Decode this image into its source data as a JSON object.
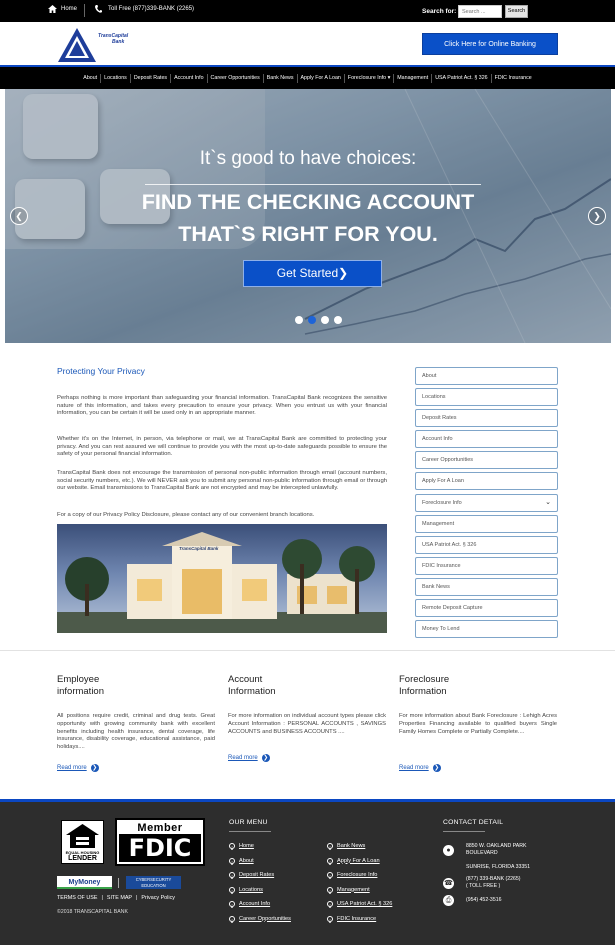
{
  "topbar": {
    "home": "Home",
    "tollfree": "Toll Free (877)339-BANK (2265)",
    "search_label": "Search for:",
    "search_placeholder": "Search ...",
    "search_button": "Search"
  },
  "header": {
    "logo_text_1": "TransCapital",
    "logo_text_2": "Bank",
    "online_banking": "Click Here for Online Banking"
  },
  "nav": [
    "About",
    "Locations",
    "Deposit Rates",
    "Account Info",
    "Career Opportunities",
    "Bank News",
    "Apply For A Loan",
    "Foreclosure Info ▾",
    "Management",
    "USA Patriot Act. § 326",
    "FDIC Insurance"
  ],
  "hero": {
    "line1": "It`s good to have choices:",
    "line2": "FIND THE CHECKING ACCOUNT",
    "line3": "THAT`S RIGHT FOR YOU.",
    "cta": "Get Started❯"
  },
  "privacy": {
    "title": "Protecting Your Privacy",
    "p1": "Perhaps nothing is more important than safeguarding your financial information. TransCapital Bank recognizes the sensitive nature of this information, and takes every precaution to ensure your privacy. When you entrust us with your financial information, you can be certain it will be used only in an appropriate manner.",
    "p2": "Whether it's on the Internet, in person, via telephone or mail, we at TransCapital Bank are committed to protecting your privacy. And you can rest assured we will continue to provide you with the most up-to-date safeguards possible to ensure the safety of your personal financial information.",
    "p3": "TransCapital Bank does not encourage the transmission of personal non-public information through email (account numbers, social security numbers, etc.). We will NEVER ask you to submit any personal non-public information through email or through our website. Email transmissions to TransCapital Bank are not encrypted and may be intercepted unlawfully.",
    "p4": "For a copy of our Privacy Policy Disclosure, please contact any of our convenient branch locations.",
    "building_sign": "TransCapital Bank"
  },
  "sidebar": [
    "About",
    "Locations",
    "Deposit Rates",
    "Account Info",
    "Career Opportunities",
    "Apply For A Loan",
    "Foreclosure Info",
    "Management",
    "USA Patriot Act. § 326",
    "FDIC Insurance",
    "Bank News",
    "Remote Deposit Capture",
    "Money To Lend"
  ],
  "columns": [
    {
      "title1": "Employee",
      "title2": "information",
      "text": "All positions require credit, criminal and drug tests. Great opportunity with growing community bank with excellent benefits including health insurance, dental coverage, life insurance, disability coverage, educational assistance, paid holidays....",
      "readmore": "Read more"
    },
    {
      "title1": "Account",
      "title2": "Information",
      "text": "For more information on individual account types please click Account Information : PERSONAL ACCOUNTS , SAVINGS ACCOUNTS and BUSINESS ACCOUNTS ....",
      "readmore": "Read more"
    },
    {
      "title1": "Foreclosure",
      "title2": "Information",
      "text": "For more information about Bank Foreclosure : Lehigh Acres Properties Financing available to qualified buyers Single Family Homes Complete or Partially Complete....",
      "readmore": "Read more"
    }
  ],
  "footer": {
    "ehl_1": "EQUAL HOUSING",
    "ehl_2": "LENDER",
    "member": "Member",
    "fdic": "FDIC",
    "mymoney": "MyMoney",
    "cyber_1": "CYBERSECURITY",
    "cyber_2": "EDUCATION",
    "links": [
      "TERMS OF USE",
      "|",
      "SITE MAP",
      "|",
      "Privacy Policy"
    ],
    "copyright": "©2018 TRANSCAPITAL BANK",
    "menu_title": "OUR MENU",
    "menu_left": [
      "Home",
      "About",
      "Deposit Rates",
      "Locations",
      "Account Info",
      "Career Opportunities"
    ],
    "menu_right": [
      "Bank News",
      "Apply For A Loan",
      "Foreclosure Info",
      "Management",
      "USA Patriot Act. § 326",
      "FDIC Insurance"
    ],
    "contact_title": "CONTACT DETAIL",
    "address_1": "8850 W. OAKLAND PARK",
    "address_2": "BOULEVARD",
    "address_3": "SUNRISE, FLORIDA 33351",
    "phone_1": "(877) 339-BANK (2265)",
    "phone_2": "( TOLL FREE )",
    "fax": "(954) 452-3516"
  },
  "colors": {
    "accent": "#0a50c8",
    "nav_bg": "#000000",
    "footer_bg": "#2d2d2d",
    "link": "#1b58b8"
  }
}
